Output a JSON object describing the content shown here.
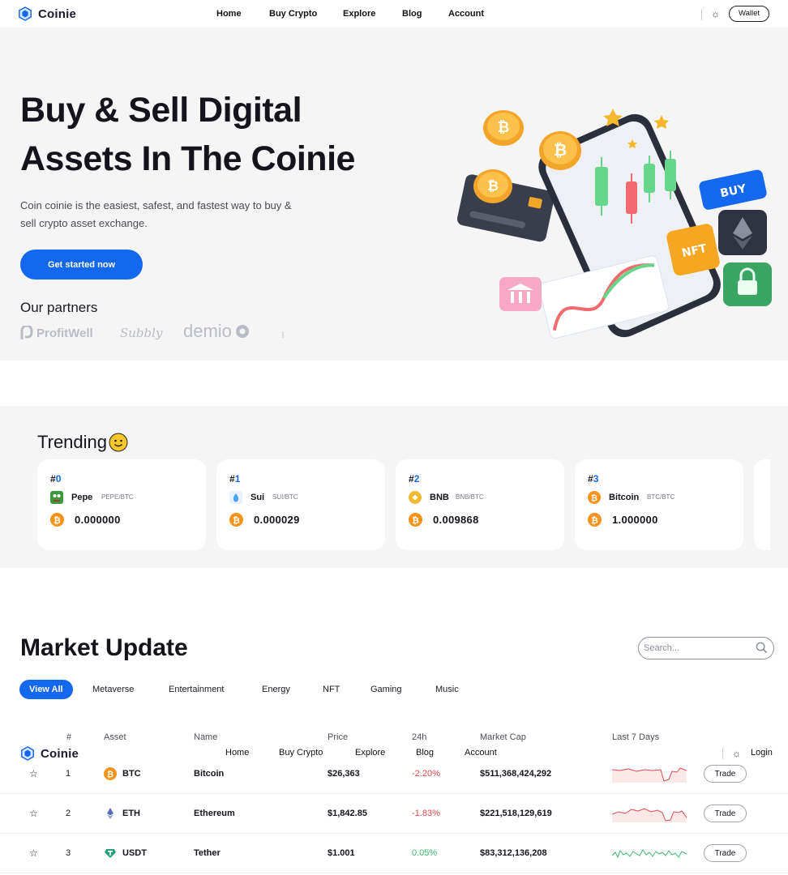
{
  "nav": {
    "brand": "Coinie",
    "links": [
      "Home",
      "Buy Crypto",
      "Explore",
      "Blog",
      "Account"
    ],
    "wallet_label": "Wallet"
  },
  "hero": {
    "title_line1": "Buy & Sell Digital",
    "title_line2": "Assets In The Coinie",
    "subtitle_line1": "Coin coinie is the easiest, safest, and fastest way to buy &",
    "subtitle_line2": "sell crypto asset exchange.",
    "cta_label": "Get started now",
    "partners_title": "Our partners",
    "partners": [
      "ProfitWell",
      "Subbly",
      "demio"
    ],
    "illustration_labels": {
      "buy": "BUY",
      "nft": "NFT"
    }
  },
  "trending": {
    "title": "Trending",
    "cards": [
      {
        "rank_prefix": "#",
        "rank": "0",
        "name": "Pepe",
        "pair": "PEPE/BTC",
        "value": "0.000000",
        "icon": "pepe-icon",
        "color": "#3a9a3a"
      },
      {
        "rank_prefix": "#",
        "rank": "1",
        "name": "Sui",
        "pair": "SUI/BTC",
        "value": "0.000029",
        "icon": "sui-icon",
        "color": "#4da2ff"
      },
      {
        "rank_prefix": "#",
        "rank": "2",
        "name": "BNB",
        "pair": "BNB/BTC",
        "value": "0.009868",
        "icon": "bnb-icon",
        "color": "#f3ba2f"
      },
      {
        "rank_prefix": "#",
        "rank": "3",
        "name": "Bitcoin",
        "pair": "BTC/BTC",
        "value": "1.000000",
        "icon": "bitcoin-icon",
        "color": "#f7931a"
      }
    ]
  },
  "market": {
    "title": "Market Update",
    "search_placeholder": "Search...",
    "filters": [
      "View All",
      "Metaverse",
      "Entertainment",
      "Energy",
      "NFT",
      "Gaming",
      "Music"
    ],
    "active_filter": "View All",
    "columns": [
      "#",
      "Asset",
      "Name",
      "Price",
      "24h",
      "Market Cap",
      "Last 7 Days"
    ],
    "rows": [
      {
        "rank": "1",
        "symbol": "BTC",
        "name": "Bitcoin",
        "price": "$26,363",
        "change": "-2.20%",
        "market_cap": "$511,368,424,292",
        "trend": "down",
        "icon": "bitcoin-icon",
        "trade": "Trade"
      },
      {
        "rank": "2",
        "symbol": "ETH",
        "name": "Ethereum",
        "price": "$1,842.85",
        "change": "-1.83%",
        "market_cap": "$221,518,129,619",
        "trend": "down",
        "icon": "ethereum-icon",
        "trade": "Trade"
      },
      {
        "rank": "3",
        "symbol": "USDT",
        "name": "Tether",
        "price": "$1.001",
        "change": "0.05%",
        "market_cap": "$83,312,136,208",
        "trend": "up",
        "icon": "tether-icon",
        "trade": "Trade"
      }
    ],
    "colors": {
      "down": "#e0474c",
      "up": "#3bba6b",
      "accent": "#1467ef"
    }
  },
  "sticky_nav": {
    "brand": "Coinie",
    "links": [
      "Home",
      "Buy Crypto",
      "Explore",
      "Blog",
      "Account"
    ],
    "login_label": "Login"
  }
}
